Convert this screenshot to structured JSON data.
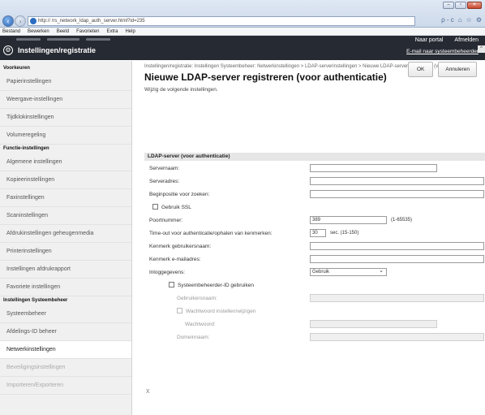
{
  "browser": {
    "url": "http://                 /rs_network_ldap_auth_server.html?id=235",
    "search_icon": "ρ - c",
    "tool_icons": [
      "home-icon",
      "star-icon",
      "gear-icon"
    ],
    "window_buttons": [
      "–",
      "▫",
      "✕"
    ]
  },
  "menu": [
    "Bestand",
    "Bewerken",
    "Beeld",
    "Favorieten",
    "Extra",
    "Help"
  ],
  "header": {
    "title": "Instellingen/registratie",
    "portal": "Naar portal",
    "logout": "Afmelden",
    "email_admin": "E-mail naar systeembeheerder"
  },
  "sidebar": {
    "sections": [
      {
        "title": "Voorkeuren",
        "items": [
          "Papierinstellingen",
          "Weergave-instellingen",
          "Tijdklokinstellingen",
          "Volumeregeling"
        ]
      },
      {
        "title": "Functie-instellingen",
        "items": [
          "Algemene instellingen",
          "Kopieerinstellingen",
          "Faxinstellingen",
          "Scaninstellingen",
          "Afdrukinstellingen geheugenmedia",
          "Printerinstellingen",
          "Instellingen afdrukrapport",
          "Favoriete instellingen"
        ]
      },
      {
        "title": "Instellingen Systeembeheer",
        "items": [
          "Systeembeheer",
          "Afdelings-ID beheer",
          "Netwerkinstellingen",
          "Beveiligingsinstellingen",
          "Importeren/Exporteren"
        ]
      }
    ]
  },
  "content": {
    "breadcrumb": "Instellingen/registratie: Instellingen Systeembeheer: Netwerkinstellingen > LDAP-serverinstellingen > Nieuwe LDAP-server registreren (voor authenticatie)",
    "title": "Nieuwe LDAP-server registreren (voor authenticatie)",
    "instruction": "Wijzig de volgende instellingen.",
    "ok": "OK",
    "cancel": "Annuleren",
    "section": "LDAP-server (voor authenticatie)",
    "fields": {
      "server_name": "Servernaam:",
      "server_address": "Serveradres:",
      "search_start": "Beginpositie voor zoeken:",
      "use_ssl": "Gebruik SSL",
      "port": "Poortnummer:",
      "port_value": "389",
      "port_hint": "(1-65535)",
      "timeout": "Time-out voor authenticatie/ophalen van kenmerken:",
      "timeout_value": "30",
      "timeout_hint": "sec. (15-150)",
      "attr_username": "Kenmerk gebruikersnaam:",
      "attr_email": "Kenmerk e-mailadres:",
      "login_info": "Inloggegevens:",
      "login_value": "Gebruik",
      "use_admin_id": "Systeembeheerder-ID gebruiken",
      "username": "Gebruikersnaam:",
      "password_setting": "Wachtwoord instellen/wijzigen",
      "password": "Wachtwoord:",
      "domain": "Domeinnaam:"
    },
    "footer_x": "x"
  }
}
